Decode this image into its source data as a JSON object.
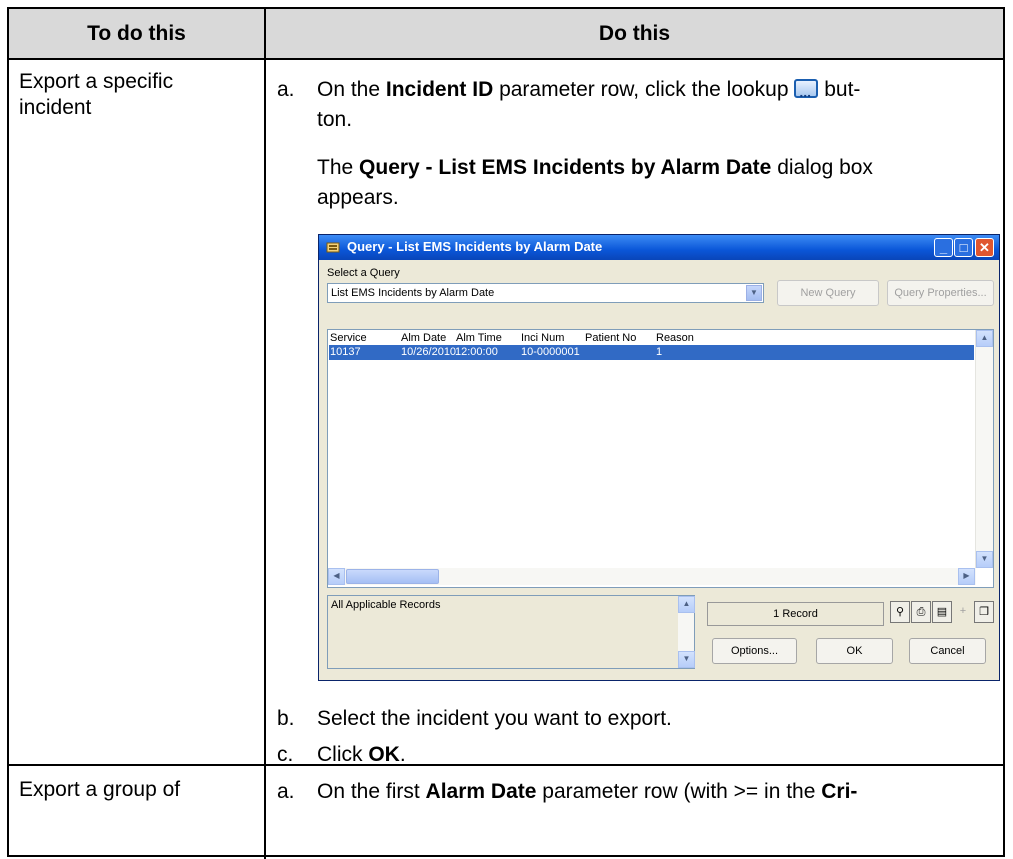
{
  "table": {
    "header_left": "To do this",
    "header_right": "Do this",
    "row1_task": "Export a specific incident",
    "row2_task": "Export a group of"
  },
  "steps": {
    "a_label": "a.",
    "a_pre": "On the ",
    "a_bold": "Incident ID",
    "a_mid": " parameter row, click the lookup ",
    "a_post": " but-ton.",
    "a_result_pre": "The ",
    "a_result_bold": "Query - List EMS Incidents by Alarm Date",
    "a_result_post": " dialog box appears.",
    "b_label": "b.",
    "b_text": "Select the incident you want to export.",
    "c_label": "c.",
    "c_pre": "Click ",
    "c_bold": "OK",
    "c_post": ".",
    "g_label": "a.",
    "g_pre": "On the first ",
    "g_bold": "Alarm Date",
    "g_mid": " parameter row (with >= in the ",
    "g_bold2": "Cri-"
  },
  "dialog": {
    "title": "Query - List EMS Incidents by Alarm Date",
    "select_label": "Select a Query",
    "selected_query": "List EMS Incidents by Alarm Date",
    "new_query": "New Query",
    "query_properties": "Query Properties...",
    "columns": [
      "Service",
      "Alm Date",
      "Alm Time",
      "Inci Num",
      "Patient No",
      "Reason"
    ],
    "row": [
      "10137",
      "10/26/2010",
      "12:00:00",
      "10-0000001",
      "",
      "1"
    ],
    "filter_text": "All Applicable Records",
    "record_count": "1 Record",
    "options": "Options...",
    "ok": "OK",
    "cancel": "Cancel"
  }
}
